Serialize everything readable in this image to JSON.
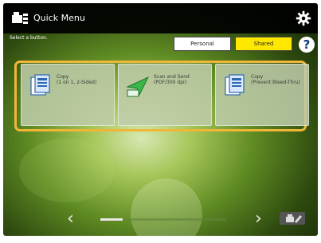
{
  "header": {
    "title": "Quick Menu"
  },
  "subtitle": "Select a button.",
  "tabs": {
    "personal": "Personal",
    "shared": "Shared"
  },
  "help": "?",
  "buttons": [
    {
      "line1": "Copy",
      "line2": "(1 on 1, 2-Sided)",
      "icon": "copy-icon"
    },
    {
      "line1": "Scan and Send",
      "line2": "(PDF/300 dpi)",
      "icon": "scan-send-icon"
    },
    {
      "line1": "Copy",
      "line2": "(Prevent Bleed-Thru)",
      "icon": "copy-icon"
    }
  ],
  "nav": {
    "prev": "‹",
    "next": "›"
  },
  "scroll_position": 0.0,
  "colors": {
    "highlight_border": "#f1b637",
    "shared_tab": "#ffe800",
    "topbar": "#000000"
  }
}
